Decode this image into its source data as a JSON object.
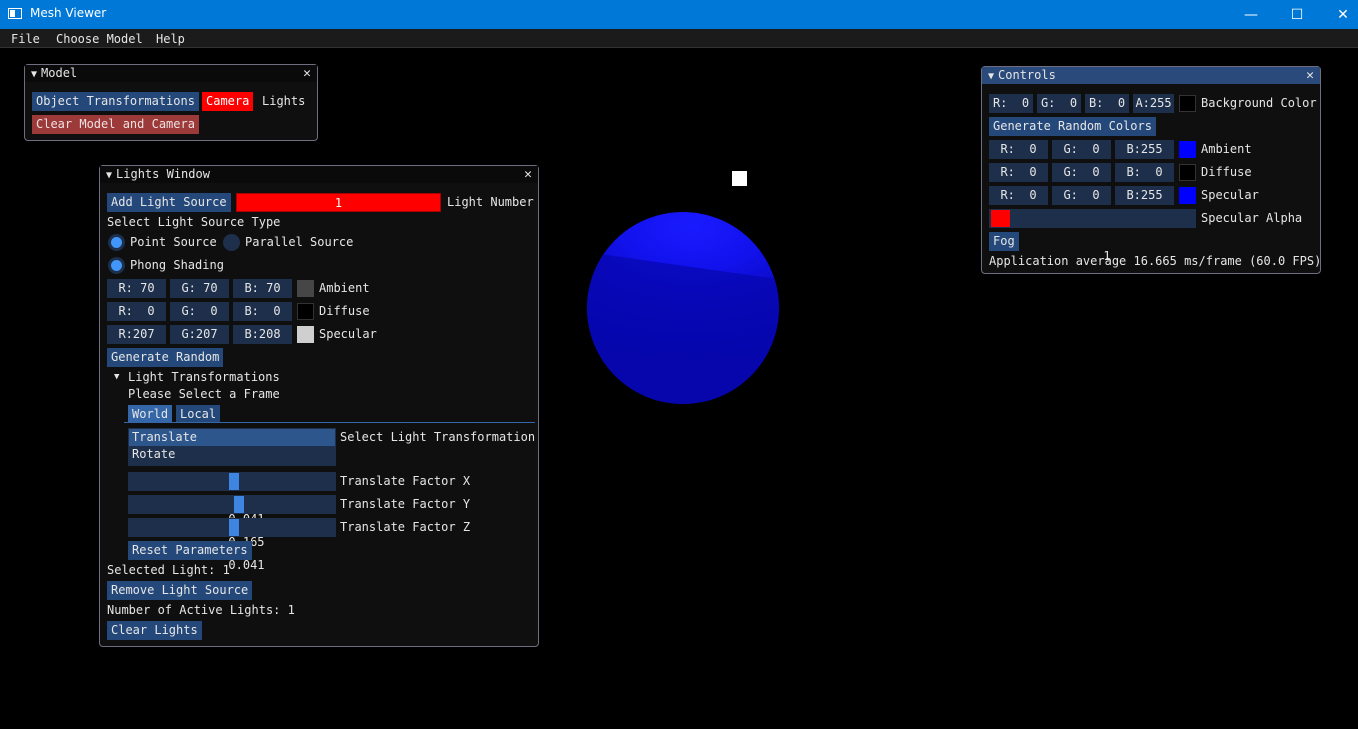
{
  "window": {
    "title": "Mesh Viewer",
    "min": "—",
    "max": "☐",
    "close": "✕"
  },
  "menu": [
    "File",
    "Choose Model",
    "Help"
  ],
  "model_window": {
    "title": "Model",
    "buttons": {
      "object_transformations": "Object Transformations",
      "camera": "Camera",
      "lights": "Lights",
      "clear": "Clear Model and Camera"
    }
  },
  "lights_window": {
    "title": "Lights Window",
    "add_light": "Add Light Source",
    "light_number_value": "1",
    "light_number_label": "Light Number",
    "select_type_label": "Select Light Source Type",
    "point_source": "Point Source",
    "parallel_source": "Parallel Source",
    "phong_shading": "Phong Shading",
    "ambient": {
      "r": "R: 70",
      "g": "G: 70",
      "b": "B: 70",
      "label": "Ambient",
      "color": "#464646"
    },
    "diffuse": {
      "r": "R:  0",
      "g": "G:  0",
      "b": "B:  0",
      "label": "Diffuse",
      "color": "#000000"
    },
    "specular": {
      "r": "R:207",
      "g": "G:207",
      "b": "B:208",
      "label": "Specular",
      "color": "#cfcfd0"
    },
    "generate_random": "Generate Random",
    "transformations_header": "Light Transformations",
    "select_frame": "Please Select a Frame",
    "tabs": [
      "World",
      "Local"
    ],
    "list_items": [
      "Translate",
      "Rotate"
    ],
    "select_transform_label": "Select Light Transformation",
    "factors": [
      {
        "value": "0.041",
        "label": "Translate Factor X",
        "fraction": 0.51
      },
      {
        "value": "0.165",
        "label": "Translate Factor Y",
        "fraction": 0.52
      },
      {
        "value": "0.041",
        "label": "Translate Factor Z",
        "fraction": 0.51
      }
    ],
    "reset": "Reset Parameters",
    "selected_light": "Selected Light: 1",
    "remove_light": "Remove Light Source",
    "active_lights": "Number of Active Lights: 1",
    "clear_lights": "Clear Lights"
  },
  "controls_window": {
    "title": "Controls",
    "bg": {
      "r": "R:  0",
      "g": "G:  0",
      "b": "B:  0",
      "a": "A:255",
      "label": "Background Color",
      "color": "#000000"
    },
    "generate_random": "Generate Random Colors",
    "ambient": {
      "r": "R:  0",
      "g": "G:  0",
      "b": "B:255",
      "label": "Ambient",
      "color": "#0000ff"
    },
    "diffuse": {
      "r": "R:  0",
      "g": "G:  0",
      "b": "B:  0",
      "label": "Diffuse",
      "color": "#000000"
    },
    "specular": {
      "r": "R:  0",
      "g": "G:  0",
      "b": "B:255",
      "label": "Specular",
      "color": "#0000ff"
    },
    "specular_alpha_value": "1",
    "specular_alpha_label": "Specular Alpha",
    "fog": "Fog",
    "fps": "Application average 16.665 ms/frame (60.0 FPS)"
  }
}
